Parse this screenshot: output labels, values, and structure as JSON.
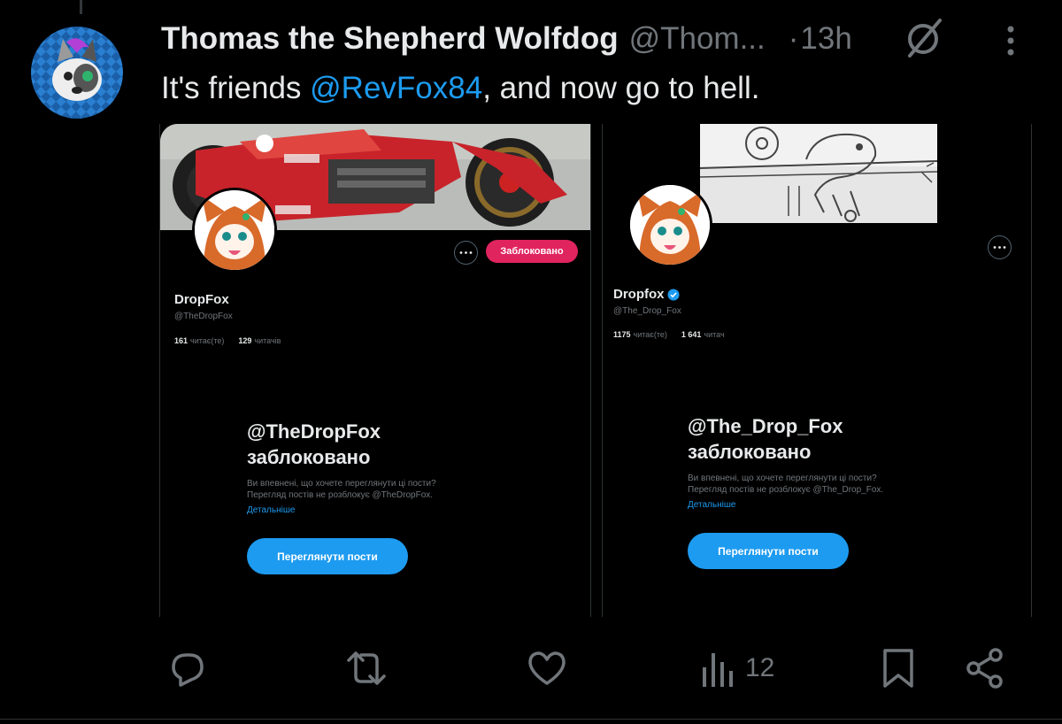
{
  "tweet": {
    "author_name": "Thomas the Shepherd Wolfdog",
    "handle": "@Thom...",
    "separator": "·",
    "time": "13h",
    "text_before": "It's friends ",
    "mention": "@RevFox84",
    "text_after": ", and now go to hell."
  },
  "left_panel": {
    "blocked_button": "Заблоковано",
    "name": "DropFox",
    "handle": "@TheDropFox",
    "following_count": "161",
    "following_label": "читає(те)",
    "followers_count": "129",
    "followers_label": "читачів",
    "blocked_title_line1": "@TheDropFox",
    "blocked_title_line2": "заблоковано",
    "blocked_text_line1": "Ви впевнені, що хочете переглянути ці пости?",
    "blocked_text_line2": "Перегляд постів не розблокує @TheDropFox.",
    "learn_more": "Детальніше",
    "view_posts_button": "Переглянути пости"
  },
  "right_panel": {
    "name": "Dropfox",
    "handle": "@The_Drop_Fox",
    "following_count": "1175",
    "following_label": "читає(те)",
    "followers_count": "1 641",
    "followers_label": "читач",
    "blocked_title_line1": "@The_Drop_Fox",
    "blocked_title_line2": "заблоковано",
    "blocked_text_line1": "Ви впевнені, що хочете переглянути ці пости?",
    "blocked_text_line2": "Перегляд постів не розблокує @The_Drop_Fox.",
    "learn_more": "Детальніше",
    "view_posts_button": "Переглянути пости"
  },
  "actions": {
    "views_count": "12",
    "icons": [
      "reply-icon",
      "retweet-icon",
      "like-icon",
      "views-icon",
      "bookmark-icon",
      "share-icon"
    ]
  },
  "colors": {
    "background": "#000000",
    "text_primary": "#e7e9ea",
    "text_secondary": "#71767b",
    "accent_blue": "#1d9bf0",
    "blocked_red": "#e0245e"
  }
}
